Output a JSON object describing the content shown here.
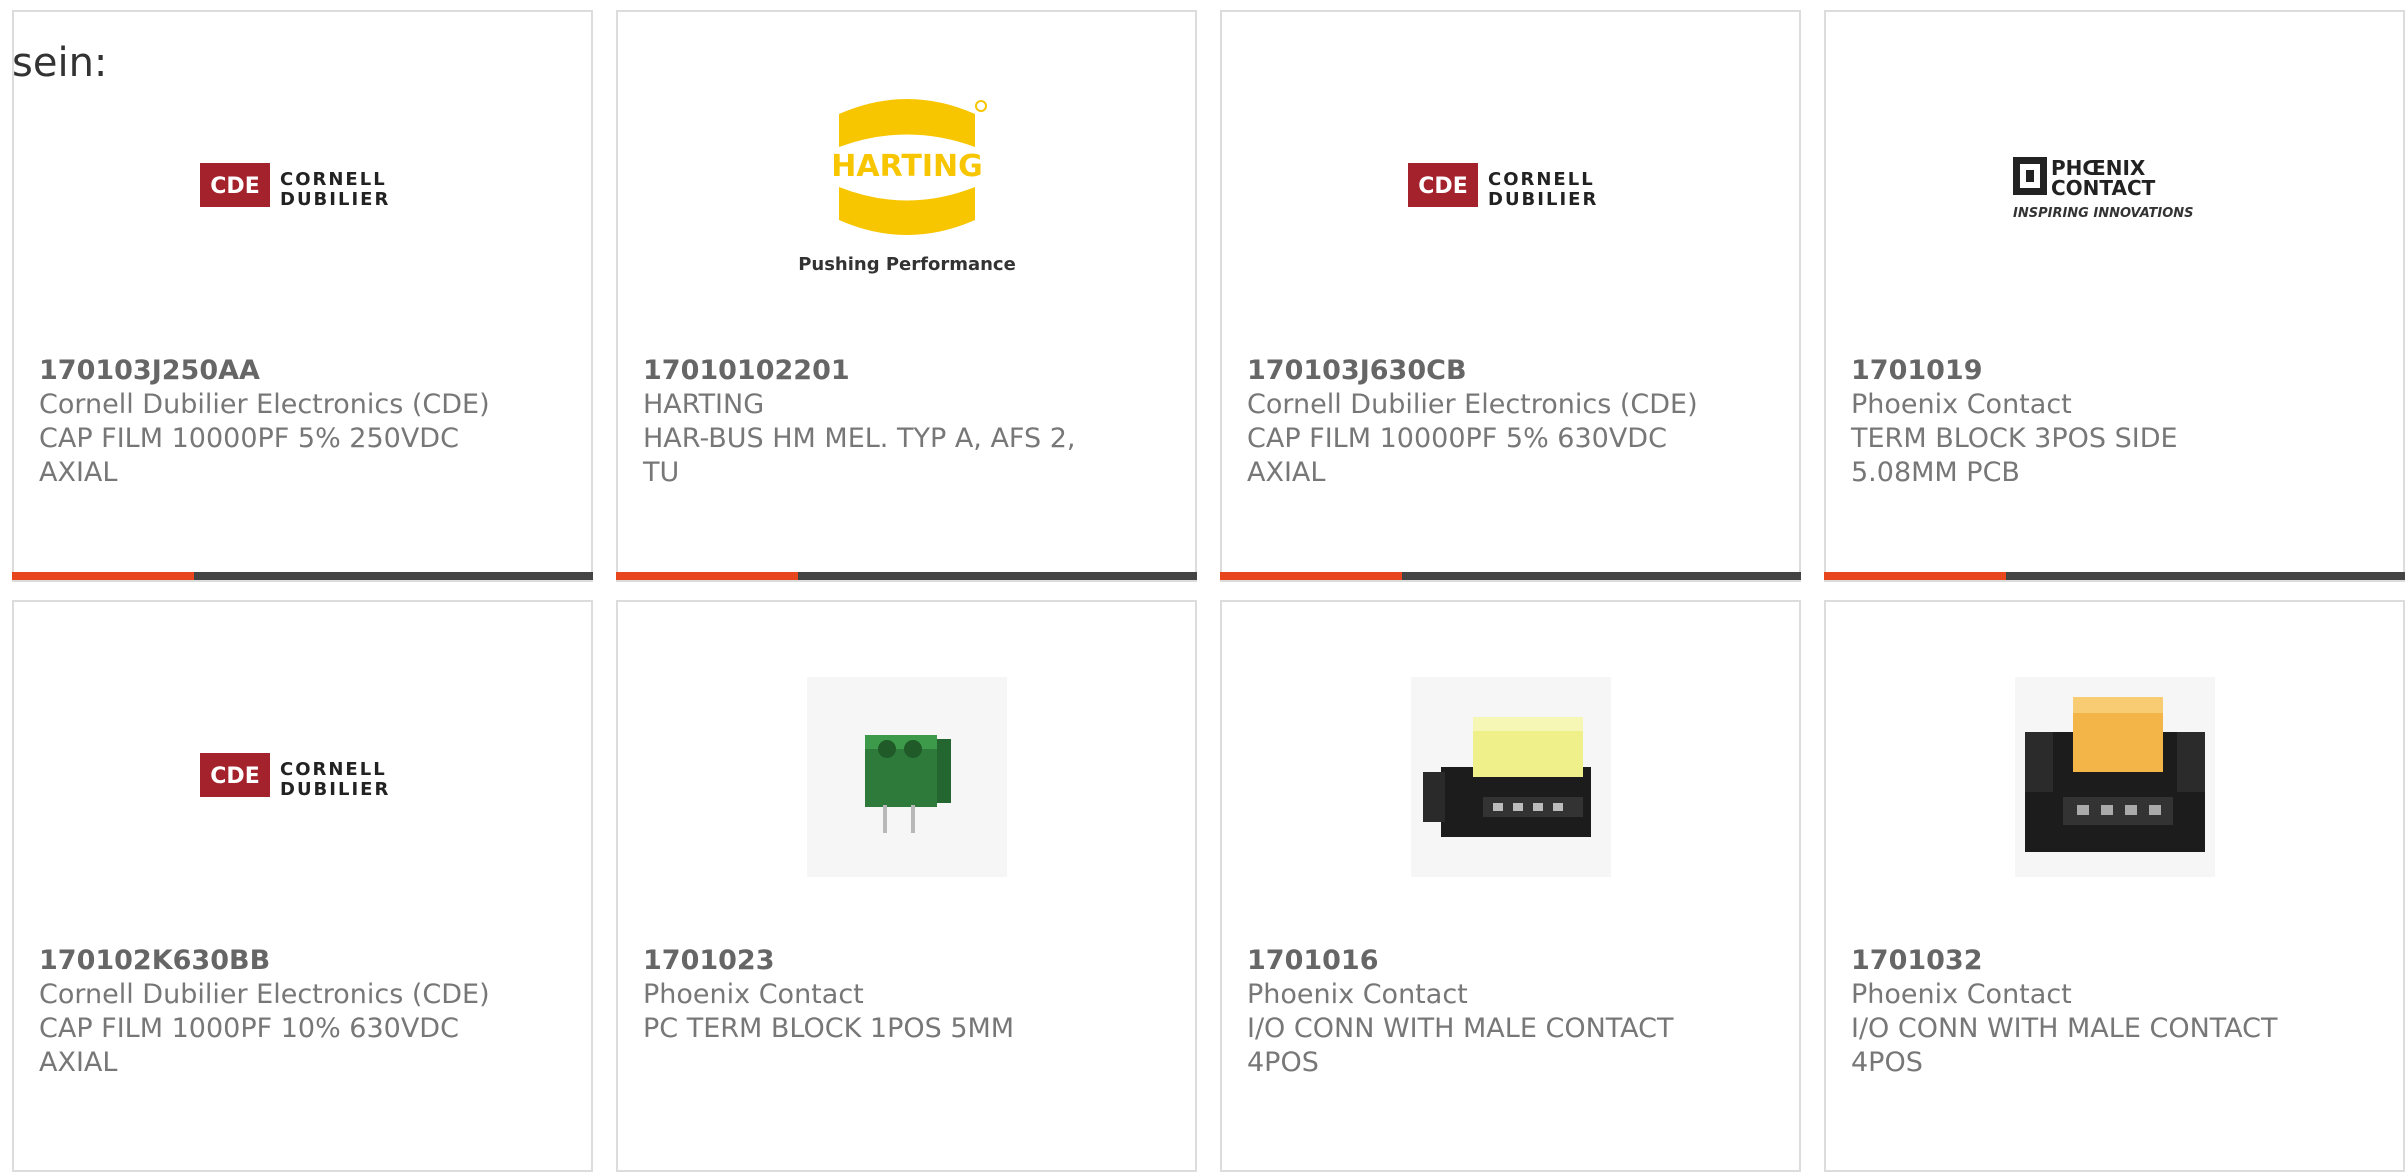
{
  "intro_text": "sein:",
  "colors": {
    "accent": "#e8461c",
    "bar_track": "#444444",
    "card_border": "#dcdcdc"
  },
  "cards": [
    {
      "part_number": "170103J250AA",
      "manufacturer": "Cornell Dubilier Electronics (CDE)",
      "description": "CAP FILM 10000PF 5% 250VDC AXIAL",
      "image": "cde-logo",
      "logo_top": "CORNELL",
      "logo_bottom": "DUBILIER",
      "logo_badge": "CDE"
    },
    {
      "part_number": "17010102201",
      "manufacturer": "HARTING",
      "description": "HAR-BUS HM MEL. TYP A, AFS 2, TU",
      "image": "harting-logo",
      "logo_word": "HARTING",
      "logo_tagline": "Pushing Performance"
    },
    {
      "part_number": "170103J630CB",
      "manufacturer": "Cornell Dubilier Electronics (CDE)",
      "description": "CAP FILM 10000PF 5% 630VDC AXIAL",
      "image": "cde-logo",
      "logo_top": "CORNELL",
      "logo_bottom": "DUBILIER",
      "logo_badge": "CDE"
    },
    {
      "part_number": "1701019",
      "manufacturer": "Phoenix Contact",
      "description": "TERM BLOCK 3POS SIDE 5.08MM PCB",
      "image": "phoenix-logo",
      "logo_top": "PHŒNIX",
      "logo_bottom": "CONTACT",
      "logo_tagline": "INSPIRING INNOVATIONS"
    },
    {
      "part_number": "170102K630BB",
      "manufacturer": "Cornell Dubilier Electronics (CDE)",
      "description": "CAP FILM 1000PF 10% 630VDC AXIAL",
      "image": "cde-logo",
      "logo_top": "CORNELL",
      "logo_bottom": "DUBILIER",
      "logo_badge": "CDE"
    },
    {
      "part_number": "1701023",
      "manufacturer": "Phoenix Contact",
      "description": "PC TERM BLOCK 1POS 5MM",
      "image": "terminal-block-photo"
    },
    {
      "part_number": "1701016",
      "manufacturer": "Phoenix Contact",
      "description": "I/O CONN WITH MALE CONTACT 4POS",
      "image": "connector-yellow-photo"
    },
    {
      "part_number": "1701032",
      "manufacturer": "Phoenix Contact",
      "description": "I/O CONN WITH MALE CONTACT 4POS",
      "image": "connector-orange-photo"
    }
  ]
}
